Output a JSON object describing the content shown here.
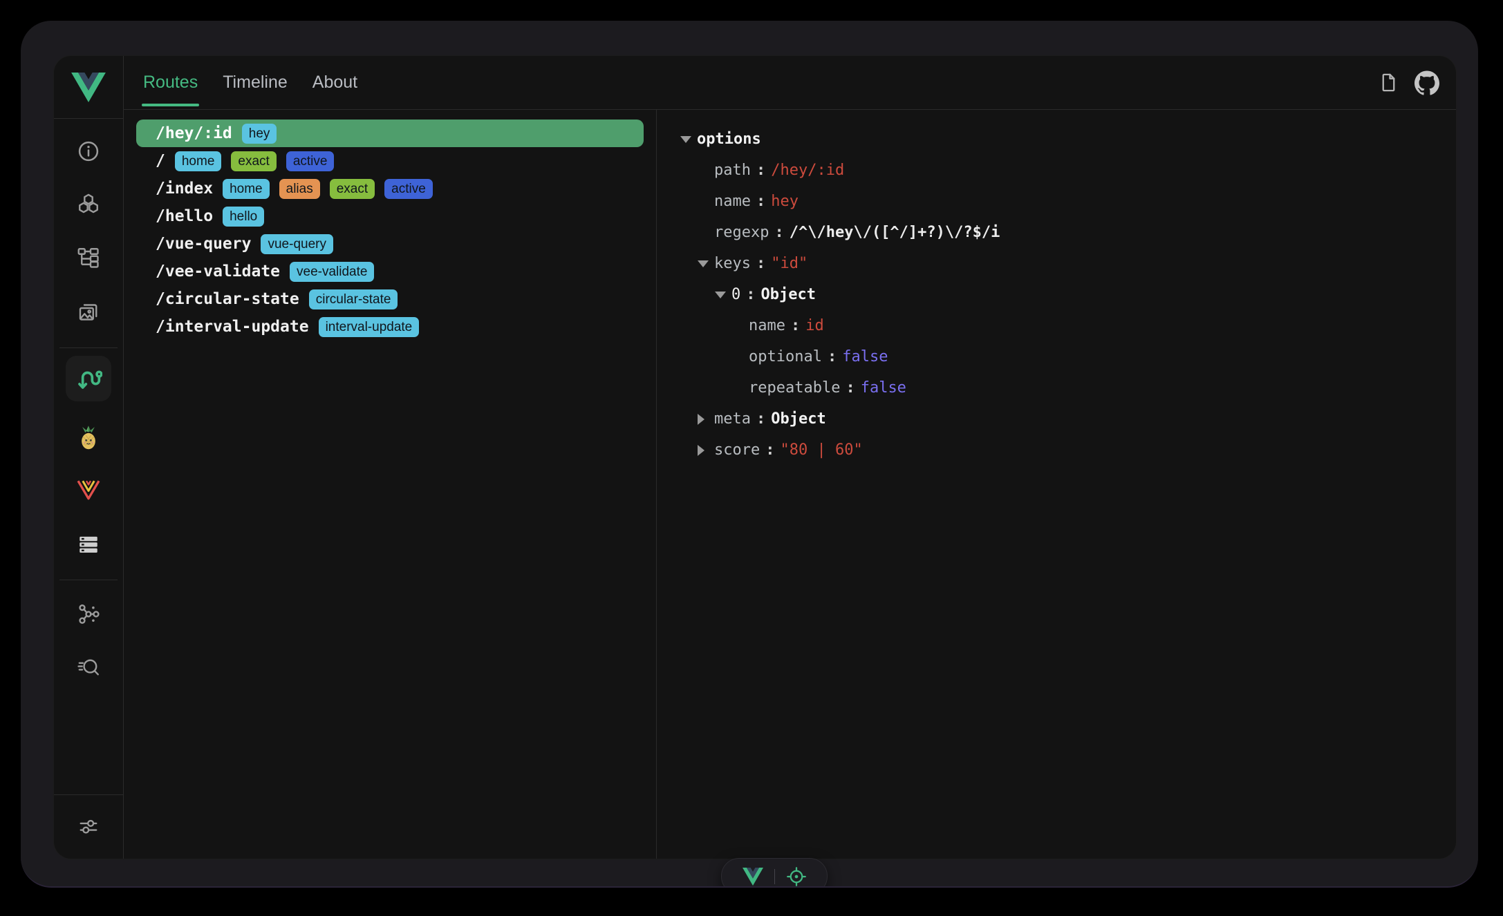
{
  "header": {
    "tabs": [
      {
        "label": "Routes",
        "active": true
      },
      {
        "label": "Timeline",
        "active": false
      },
      {
        "label": "About",
        "active": false
      }
    ],
    "action_icons": [
      "document-icon",
      "github-icon"
    ]
  },
  "sidebar": {
    "icons": [
      "info-icon",
      "components-icon",
      "component-tree-icon",
      "assets-icon",
      "router-icon",
      "pinia-icon",
      "vee-validate-icon",
      "list-icon",
      "graph-icon",
      "inspector-icon",
      "settings-icon"
    ],
    "active_icon": "router-icon"
  },
  "routes": {
    "items": [
      {
        "path": "/hey/:id",
        "selected": true,
        "badges": [
          {
            "label": "hey",
            "type": "name"
          }
        ]
      },
      {
        "path": "/",
        "selected": false,
        "badges": [
          {
            "label": "home",
            "type": "name"
          },
          {
            "label": "exact",
            "type": "exact"
          },
          {
            "label": "active",
            "type": "active"
          }
        ]
      },
      {
        "path": "/index",
        "selected": false,
        "badges": [
          {
            "label": "home",
            "type": "name"
          },
          {
            "label": "alias",
            "type": "alias"
          },
          {
            "label": "exact",
            "type": "exact"
          },
          {
            "label": "active",
            "type": "active"
          }
        ]
      },
      {
        "path": "/hello",
        "selected": false,
        "badges": [
          {
            "label": "hello",
            "type": "name"
          }
        ]
      },
      {
        "path": "/vue-query",
        "selected": false,
        "badges": [
          {
            "label": "vue-query",
            "type": "name"
          }
        ]
      },
      {
        "path": "/vee-validate",
        "selected": false,
        "badges": [
          {
            "label": "vee-validate",
            "type": "name"
          }
        ]
      },
      {
        "path": "/circular-state",
        "selected": false,
        "badges": [
          {
            "label": "circular-state",
            "type": "name"
          }
        ]
      },
      {
        "path": "/interval-update",
        "selected": false,
        "badges": [
          {
            "label": "interval-update",
            "type": "name"
          }
        ]
      }
    ]
  },
  "inspector": {
    "rows": [
      {
        "indent": 0,
        "arrow": "down",
        "key": "options",
        "key_style": "root"
      },
      {
        "indent": 1,
        "arrow": null,
        "key": "path",
        "value": "/hey/:id",
        "value_style": "string"
      },
      {
        "indent": 1,
        "arrow": null,
        "key": "name",
        "value": "hey",
        "value_style": "string"
      },
      {
        "indent": 1,
        "arrow": null,
        "key": "regexp",
        "value": "/^\\/hey\\/([^/]+?)\\/?$/i",
        "value_style": "plain"
      },
      {
        "indent": 1,
        "arrow": "down",
        "key": "keys",
        "value": "\"id\"",
        "value_style": "string"
      },
      {
        "indent": 2,
        "arrow": "down",
        "key": "0",
        "key_style": "index",
        "value": "Object",
        "value_style": "object"
      },
      {
        "indent": 3,
        "arrow": null,
        "key": "name",
        "value": "id",
        "value_style": "string"
      },
      {
        "indent": 3,
        "arrow": null,
        "key": "optional",
        "value": "false",
        "value_style": "boolean"
      },
      {
        "indent": 3,
        "arrow": null,
        "key": "repeatable",
        "value": "false",
        "value_style": "boolean"
      },
      {
        "indent": 1,
        "arrow": "right",
        "key": "meta",
        "value": "Object",
        "value_style": "object"
      },
      {
        "indent": 1,
        "arrow": "right",
        "key": "score",
        "value": "\"80 | 60\"",
        "value_style": "string"
      }
    ]
  },
  "footer_toolbar": {
    "icons": [
      "vue-logo-icon",
      "inspect-target-icon"
    ]
  },
  "colors": {
    "accent_green": "#42b883",
    "vue_slate": "#35495e",
    "selected_row": "#4f9e6c",
    "badges": {
      "name": "#5ac3e1",
      "exact": "#86bd3e",
      "alias": "#e49352",
      "active": "#3e63d7"
    },
    "value_string": "#cd4b3d",
    "value_boolean": "#7a6ff0"
  }
}
